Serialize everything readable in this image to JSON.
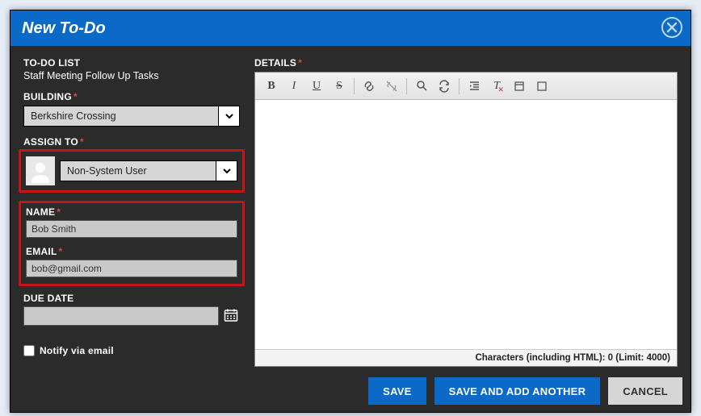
{
  "header": {
    "title": "New To-Do"
  },
  "left": {
    "todo_list_label": "TO-DO LIST",
    "todo_list_value": "Staff Meeting Follow Up Tasks",
    "building_label": "BUILDING",
    "building_value": "Berkshire Crossing",
    "assign_to_label": "ASSIGN TO",
    "assign_to_value": "Non-System User",
    "name_label": "NAME",
    "name_value": "Bob Smith",
    "email_label": "EMAIL",
    "email_value": "bob@gmail.com",
    "due_date_label": "DUE DATE",
    "due_date_value": "",
    "notify_label": "Notify via email"
  },
  "right": {
    "details_label": "DETAILS",
    "char_count": "Characters (including HTML): 0 (Limit: 4000)"
  },
  "footer": {
    "save": "SAVE",
    "save_add": "SAVE AND ADD ANOTHER",
    "cancel": "CANCEL"
  }
}
